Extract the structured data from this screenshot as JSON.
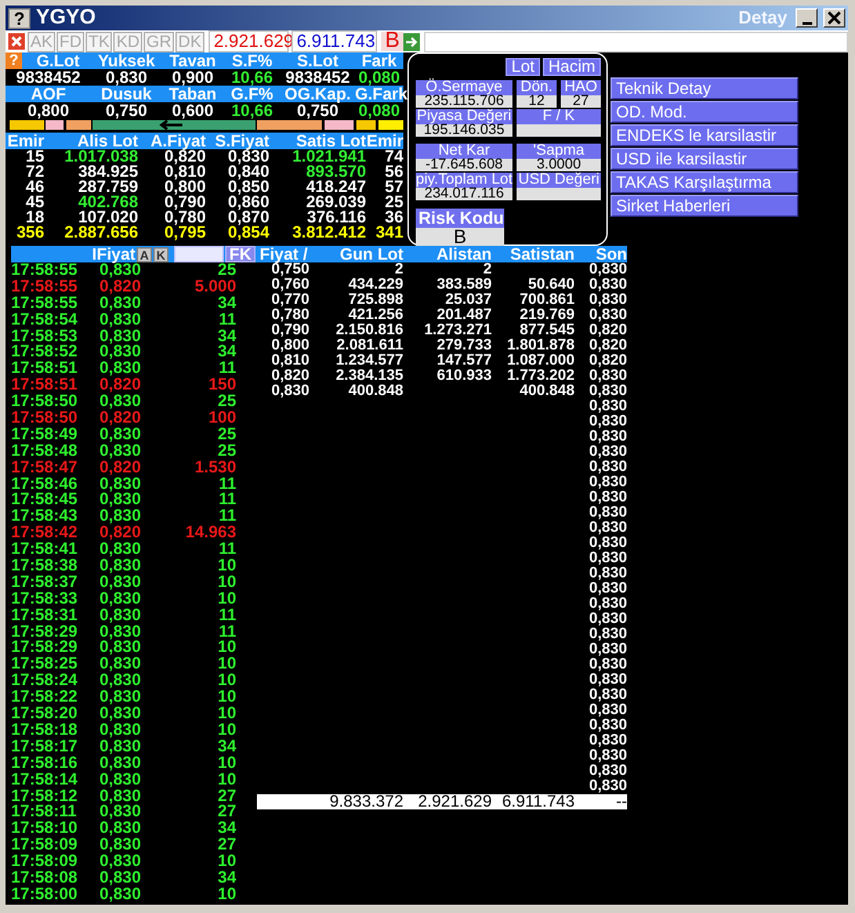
{
  "window": {
    "icon_text": "?",
    "title": "YGYO",
    "caption_right": "Detay"
  },
  "toolbar": {
    "tabs": [
      {
        "label": "AK",
        "disabled": true
      },
      {
        "label": "FD",
        "disabled": true
      },
      {
        "label": "TK",
        "disabled": true
      },
      {
        "label": "KD",
        "disabled": true
      },
      {
        "label": "GR",
        "disabled": true
      },
      {
        "label": "DK",
        "disabled": true
      }
    ],
    "sell_total": "2.921.629",
    "buy_total": "6.911.743",
    "flag": "B"
  },
  "quote": {
    "help": "?",
    "blocks": [
      {
        "headers": [
          "G.Lot",
          "Yuksek",
          "Tavan",
          "S.F%",
          "S.Lot",
          "Fark"
        ],
        "values": [
          {
            "text": "9838452",
            "highlighted": false
          },
          {
            "text": "0,830",
            "highlighted": false
          },
          {
            "text": "0,900",
            "highlighted": false
          },
          {
            "text": "10,66",
            "highlighted": true
          },
          {
            "text": "9838452",
            "highlighted": false
          },
          {
            "text": "0,080",
            "highlighted": true
          }
        ]
      },
      {
        "headers": [
          "AOF",
          "Dusuk",
          "Taban",
          "G.F%",
          "OG.Kap.",
          "G.Fark"
        ],
        "values": [
          {
            "text": "0,800",
            "highlighted": false
          },
          {
            "text": "0,750",
            "highlighted": false
          },
          {
            "text": "0,600",
            "highlighted": false
          },
          {
            "text": "10,66",
            "highlighted": true
          },
          {
            "text": "0,750",
            "highlighted": false
          },
          {
            "text": "0,080",
            "highlighted": true
          }
        ]
      }
    ]
  },
  "order_book": {
    "columns": [
      "Emir",
      "Alis Lot",
      "A.Fiyat",
      "S.Fiyat",
      "Satis Lot",
      "Emir"
    ],
    "rows": [
      {
        "cells": [
          {
            "text": "15",
            "highlighted": false
          },
          {
            "text": "1.017.038",
            "highlighted": true
          },
          {
            "text": "0,820",
            "highlighted": false
          },
          {
            "text": "0,830",
            "highlighted": false
          },
          {
            "text": "1.021.941",
            "highlighted": true
          },
          {
            "text": "74",
            "highlighted": false
          }
        ]
      },
      {
        "cells": [
          {
            "text": "72",
            "highlighted": false
          },
          {
            "text": "384.925",
            "highlighted": false
          },
          {
            "text": "0,810",
            "highlighted": false
          },
          {
            "text": "0,840",
            "highlighted": false
          },
          {
            "text": "893.570",
            "highlighted": true
          },
          {
            "text": "56",
            "highlighted": false
          }
        ]
      },
      {
        "cells": [
          {
            "text": "46",
            "highlighted": false
          },
          {
            "text": "287.759",
            "highlighted": false
          },
          {
            "text": "0,800",
            "highlighted": false
          },
          {
            "text": "0,850",
            "highlighted": false
          },
          {
            "text": "418.247",
            "highlighted": false
          },
          {
            "text": "57",
            "highlighted": false
          }
        ]
      },
      {
        "cells": [
          {
            "text": "45",
            "highlighted": false
          },
          {
            "text": "402.768",
            "highlighted": true
          },
          {
            "text": "0,790",
            "highlighted": false
          },
          {
            "text": "0,860",
            "highlighted": false
          },
          {
            "text": "269.039",
            "highlighted": false
          },
          {
            "text": "25",
            "highlighted": false
          }
        ]
      },
      {
        "cells": [
          {
            "text": "18",
            "highlighted": false
          },
          {
            "text": "107.020",
            "highlighted": false
          },
          {
            "text": "0,780",
            "highlighted": false
          },
          {
            "text": "0,870",
            "highlighted": false
          },
          {
            "text": "376.116",
            "highlighted": false
          },
          {
            "text": "36",
            "highlighted": false
          }
        ]
      }
    ],
    "total": [
      "356",
      "2.887.656",
      "0,795",
      "0,854",
      "3.812.412",
      "341"
    ]
  },
  "detail": {
    "toggles": [
      "Lot",
      "Hacim"
    ],
    "rows": [
      [
        {
          "label": "Ö.Sermaye",
          "value": "235.115.706"
        },
        {
          "label": "Dön.",
          "value": "12"
        },
        {
          "label": "HAO",
          "value": "27"
        }
      ],
      [
        {
          "label": "Piyasa Değeri",
          "value": "195.146.035"
        },
        {
          "label": "F / K"
        }
      ],
      [
        {
          "label": "Net Kar",
          "value": "-17.645.608"
        },
        {
          "label": "'Sapma",
          "value": "3.0000"
        }
      ],
      [
        {
          "label": "piy.Toplam Lot",
          "value": "234.017.116"
        },
        {
          "label": "USD Değeri"
        }
      ]
    ],
    "risk_label": "Risk Kodu",
    "risk_value": "B"
  },
  "menu": [
    "Teknik Detay",
    "OD. Mod.",
    "ENDEKS le karsilastir",
    "USD ile karsilastir",
    "TAKAS Karşılaştırma",
    "Sirket Haberleri"
  ],
  "trades": {
    "price_label": "IFiyat",
    "buttons": [
      "A",
      "K"
    ],
    "filter_button": "FK",
    "rows": [
      {
        "time": "17:58:55",
        "price": "0,830",
        "size": "25",
        "sell": false
      },
      {
        "time": "17:58:55",
        "price": "0,820",
        "size": "5.000",
        "sell": true
      },
      {
        "time": "17:58:55",
        "price": "0,830",
        "size": "34",
        "sell": false
      },
      {
        "time": "17:58:54",
        "price": "0,830",
        "size": "11",
        "sell": false
      },
      {
        "time": "17:58:53",
        "price": "0,830",
        "size": "34",
        "sell": false
      },
      {
        "time": "17:58:52",
        "price": "0,830",
        "size": "34",
        "sell": false
      },
      {
        "time": "17:58:51",
        "price": "0,830",
        "size": "11",
        "sell": false
      },
      {
        "time": "17:58:51",
        "price": "0,820",
        "size": "150",
        "sell": true
      },
      {
        "time": "17:58:50",
        "price": "0,830",
        "size": "25",
        "sell": false
      },
      {
        "time": "17:58:50",
        "price": "0,820",
        "size": "100",
        "sell": true
      },
      {
        "time": "17:58:49",
        "price": "0,830",
        "size": "25",
        "sell": false
      },
      {
        "time": "17:58:48",
        "price": "0,830",
        "size": "25",
        "sell": false
      },
      {
        "time": "17:58:47",
        "price": "0,820",
        "size": "1.530",
        "sell": true
      },
      {
        "time": "17:58:46",
        "price": "0,830",
        "size": "11",
        "sell": false
      },
      {
        "time": "17:58:45",
        "price": "0,830",
        "size": "11",
        "sell": false
      },
      {
        "time": "17:58:43",
        "price": "0,830",
        "size": "11",
        "sell": false
      },
      {
        "time": "17:58:42",
        "price": "0,820",
        "size": "14.963",
        "sell": true
      },
      {
        "time": "17:58:41",
        "price": "0,830",
        "size": "11",
        "sell": false
      },
      {
        "time": "17:58:38",
        "price": "0,830",
        "size": "10",
        "sell": false
      },
      {
        "time": "17:58:37",
        "price": "0,830",
        "size": "10",
        "sell": false
      },
      {
        "time": "17:58:33",
        "price": "0,830",
        "size": "10",
        "sell": false
      },
      {
        "time": "17:58:31",
        "price": "0,830",
        "size": "11",
        "sell": false
      },
      {
        "time": "17:58:29",
        "price": "0,830",
        "size": "11",
        "sell": false
      },
      {
        "time": "17:58:29",
        "price": "0,830",
        "size": "10",
        "sell": false
      },
      {
        "time": "17:58:25",
        "price": "0,830",
        "size": "10",
        "sell": false
      },
      {
        "time": "17:58:24",
        "price": "0,830",
        "size": "10",
        "sell": false
      },
      {
        "time": "17:58:22",
        "price": "0,830",
        "size": "10",
        "sell": false
      },
      {
        "time": "17:58:20",
        "price": "0,830",
        "size": "10",
        "sell": false
      },
      {
        "time": "17:58:18",
        "price": "0,830",
        "size": "10",
        "sell": false
      },
      {
        "time": "17:58:17",
        "price": "0,830",
        "size": "34",
        "sell": false
      },
      {
        "time": "17:58:16",
        "price": "0,830",
        "size": "10",
        "sell": false
      },
      {
        "time": "17:58:14",
        "price": "0,830",
        "size": "10",
        "sell": false
      },
      {
        "time": "17:58:12",
        "price": "0,830",
        "size": "27",
        "sell": false
      },
      {
        "time": "17:58:11",
        "price": "0,830",
        "size": "27",
        "sell": false
      },
      {
        "time": "17:58:10",
        "price": "0,830",
        "size": "34",
        "sell": false
      },
      {
        "time": "17:58:09",
        "price": "0,830",
        "size": "27",
        "sell": false
      },
      {
        "time": "17:58:09",
        "price": "0,830",
        "size": "10",
        "sell": false
      },
      {
        "time": "17:58:08",
        "price": "0,830",
        "size": "34",
        "sell": false
      },
      {
        "time": "17:58:00",
        "price": "0,830",
        "size": "10",
        "sell": false
      }
    ]
  },
  "price_table": {
    "columns": [
      "Fiyat /",
      "Gun Lot",
      "Alistan",
      "Satistan",
      "Son"
    ],
    "rows": [
      {
        "price": "0,750",
        "gun_lot": "2",
        "alistan": "2",
        "son": "0,830"
      },
      {
        "price": "0,760",
        "gun_lot": "434.229",
        "alistan": "383.589",
        "satistan": "50.640",
        "son": "0,830"
      },
      {
        "price": "0,770",
        "gun_lot": "725.898",
        "alistan": "25.037",
        "satistan": "700.861",
        "son": "0,830"
      },
      {
        "price": "0,780",
        "gun_lot": "421.256",
        "alistan": "201.487",
        "satistan": "219.769",
        "son": "0,830"
      },
      {
        "price": "0,790",
        "gun_lot": "2.150.816",
        "alistan": "1.273.271",
        "satistan": "877.545",
        "son": "0,820"
      },
      {
        "price": "0,800",
        "gun_lot": "2.081.611",
        "alistan": "279.733",
        "satistan": "1.801.878",
        "son": "0,820"
      },
      {
        "price": "0,810",
        "gun_lot": "1.234.577",
        "alistan": "147.577",
        "satistan": "1.087.000",
        "son": "0,820"
      },
      {
        "price": "0,820",
        "gun_lot": "2.384.135",
        "alistan": "610.933",
        "satistan": "1.773.202",
        "son": "0,830"
      },
      {
        "price": "0,830",
        "gun_lot": "400.848",
        "satistan": "400.848",
        "son": "0,830"
      },
      {
        "son": "0,830"
      },
      {
        "son": "0,830"
      },
      {
        "son": "0,830"
      },
      {
        "son": "0,830"
      },
      {
        "son": "0,830"
      },
      {
        "son": "0,830"
      },
      {
        "son": "0,830"
      },
      {
        "son": "0,830"
      },
      {
        "son": "0,830"
      },
      {
        "son": "0,830"
      },
      {
        "son": "0,830"
      },
      {
        "son": "0,830"
      },
      {
        "son": "0,830"
      },
      {
        "son": "0,830"
      },
      {
        "son": "0,830"
      },
      {
        "son": "0,830"
      },
      {
        "son": "0,830"
      },
      {
        "son": "0,830"
      },
      {
        "son": "0,830"
      },
      {
        "son": "0,830"
      },
      {
        "son": "0,830"
      },
      {
        "son": "0,830"
      },
      {
        "son": "0,830"
      },
      {
        "son": "0,830"
      },
      {
        "son": "0,830"
      },
      {
        "son": "0,830"
      }
    ],
    "total": {
      "gun_lot": "9.833.372",
      "alistan": "2.921.629",
      "satistan": "6.911.743",
      "son": "--"
    }
  }
}
